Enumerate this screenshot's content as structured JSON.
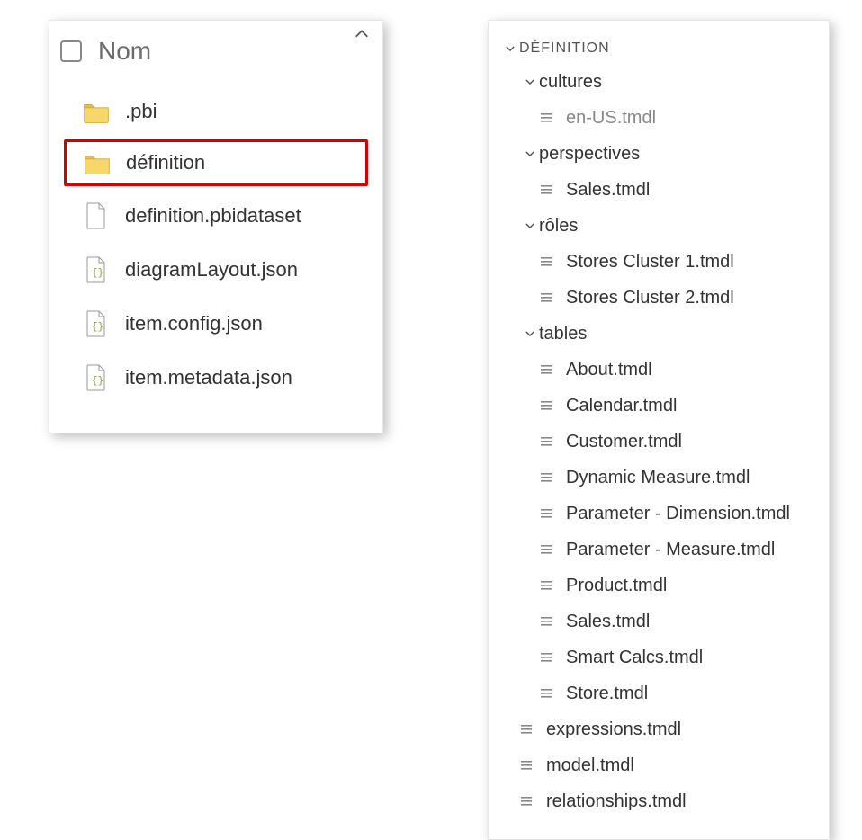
{
  "left": {
    "header_label": "Nom",
    "items": [
      {
        "type": "folder",
        "label": ".pbi",
        "highlighted": false
      },
      {
        "type": "folder",
        "label": "définition",
        "highlighted": true
      },
      {
        "type": "doc",
        "label": "definition.pbidataset"
      },
      {
        "type": "json",
        "label": "diagramLayout.json"
      },
      {
        "type": "json",
        "label": "item.config.json"
      },
      {
        "type": "json",
        "label": "item.metadata.json"
      }
    ]
  },
  "right": {
    "root_label": "DÉFINITION",
    "tree": [
      {
        "depth": 1,
        "kind": "folder",
        "label": "cultures"
      },
      {
        "depth": 2,
        "kind": "file",
        "label": "en-US.tmdl",
        "muted": true
      },
      {
        "depth": 1,
        "kind": "folder",
        "label": "perspectives"
      },
      {
        "depth": 2,
        "kind": "file",
        "label": "Sales.tmdl"
      },
      {
        "depth": 1,
        "kind": "folder",
        "label": "rôles"
      },
      {
        "depth": 2,
        "kind": "file",
        "label": "Stores Cluster 1.tmdl"
      },
      {
        "depth": 2,
        "kind": "file",
        "label": "Stores Cluster 2.tmdl"
      },
      {
        "depth": 1,
        "kind": "folder",
        "label": "tables"
      },
      {
        "depth": 2,
        "kind": "file",
        "label": "About.tmdl"
      },
      {
        "depth": 2,
        "kind": "file",
        "label": "Calendar.tmdl"
      },
      {
        "depth": 2,
        "kind": "file",
        "label": "Customer.tmdl"
      },
      {
        "depth": 2,
        "kind": "file",
        "label": "Dynamic Measure.tmdl"
      },
      {
        "depth": 2,
        "kind": "file",
        "label": "Parameter - Dimension.tmdl"
      },
      {
        "depth": 2,
        "kind": "file",
        "label": "Parameter - Measure.tmdl"
      },
      {
        "depth": 2,
        "kind": "file",
        "label": "Product.tmdl"
      },
      {
        "depth": 2,
        "kind": "file",
        "label": "Sales.tmdl"
      },
      {
        "depth": 2,
        "kind": "file",
        "label": "Smart Calcs.tmdl"
      },
      {
        "depth": 2,
        "kind": "file",
        "label": "Store.tmdl"
      },
      {
        "depth": 1,
        "kind": "file",
        "label": "expressions.tmdl"
      },
      {
        "depth": 1,
        "kind": "file",
        "label": "model.tmdl"
      },
      {
        "depth": 1,
        "kind": "file",
        "label": "relationships.tmdl"
      }
    ]
  }
}
